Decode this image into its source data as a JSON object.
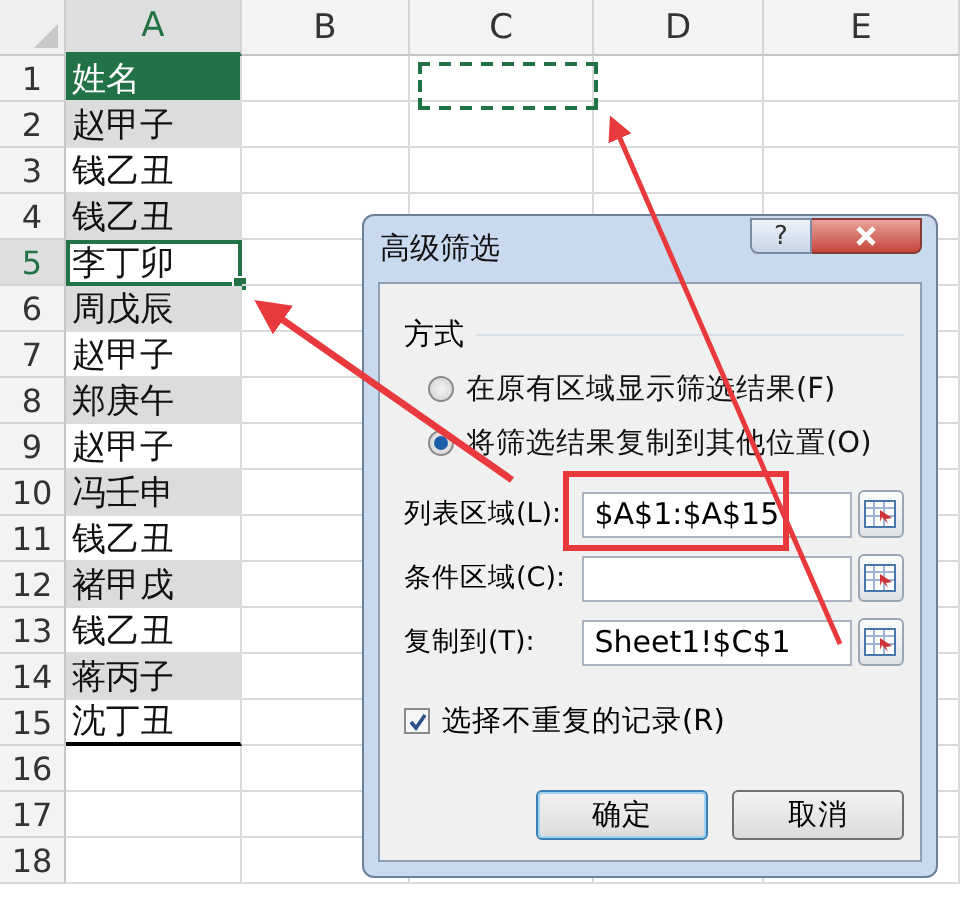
{
  "sheet": {
    "columns": [
      {
        "label": "A",
        "selected": true
      },
      {
        "label": "B",
        "selected": false
      },
      {
        "label": "C",
        "selected": false
      },
      {
        "label": "D",
        "selected": false
      },
      {
        "label": "E",
        "selected": false
      }
    ],
    "rows": [
      {
        "number": "1",
        "value": "姓名",
        "kind": "header",
        "selected": false
      },
      {
        "number": "2",
        "value": "赵甲子",
        "kind": "shaded",
        "selected": false
      },
      {
        "number": "3",
        "value": "钱乙丑",
        "kind": "plain",
        "selected": false
      },
      {
        "number": "4",
        "value": "钱乙丑",
        "kind": "shaded",
        "selected": false
      },
      {
        "number": "5",
        "value": "李丁卯",
        "kind": "plain",
        "selected": true
      },
      {
        "number": "6",
        "value": "周戊辰",
        "kind": "shaded",
        "selected": false
      },
      {
        "number": "7",
        "value": "赵甲子",
        "kind": "plain",
        "selected": false
      },
      {
        "number": "8",
        "value": "郑庚午",
        "kind": "shaded",
        "selected": false
      },
      {
        "number": "9",
        "value": "赵甲子",
        "kind": "plain",
        "selected": false
      },
      {
        "number": "10",
        "value": "冯壬申",
        "kind": "shaded",
        "selected": false
      },
      {
        "number": "11",
        "value": "钱乙丑",
        "kind": "plain",
        "selected": false
      },
      {
        "number": "12",
        "value": "褚甲戌",
        "kind": "shaded",
        "selected": false
      },
      {
        "number": "13",
        "value": "钱乙丑",
        "kind": "plain",
        "selected": false
      },
      {
        "number": "14",
        "value": "蒋丙子",
        "kind": "shaded",
        "selected": false
      },
      {
        "number": "15",
        "value": "沈丁丑",
        "kind": "last",
        "selected": false
      },
      {
        "number": "16",
        "kind": "empty",
        "selected": false
      },
      {
        "number": "17",
        "kind": "empty",
        "selected": false
      },
      {
        "number": "18",
        "kind": "empty",
        "selected": false
      }
    ]
  },
  "dialog": {
    "title": "高级筛选",
    "help": "?",
    "group": "方式",
    "radios": [
      {
        "label": "在原有区域显示筛选结果(F)",
        "selected": false
      },
      {
        "label": "将筛选结果复制到其他位置(O)",
        "selected": true
      }
    ],
    "fields": [
      {
        "label": "列表区域(L):",
        "value": "$A$1:$A$15"
      },
      {
        "label": "条件区域(C):"
      },
      {
        "label": "复制到(T):",
        "value": "Sheet1!$C$1"
      }
    ],
    "checkbox": {
      "label": "选择不重复的记录(R)",
      "checked": true
    },
    "buttons": [
      "确定",
      "取消"
    ]
  }
}
